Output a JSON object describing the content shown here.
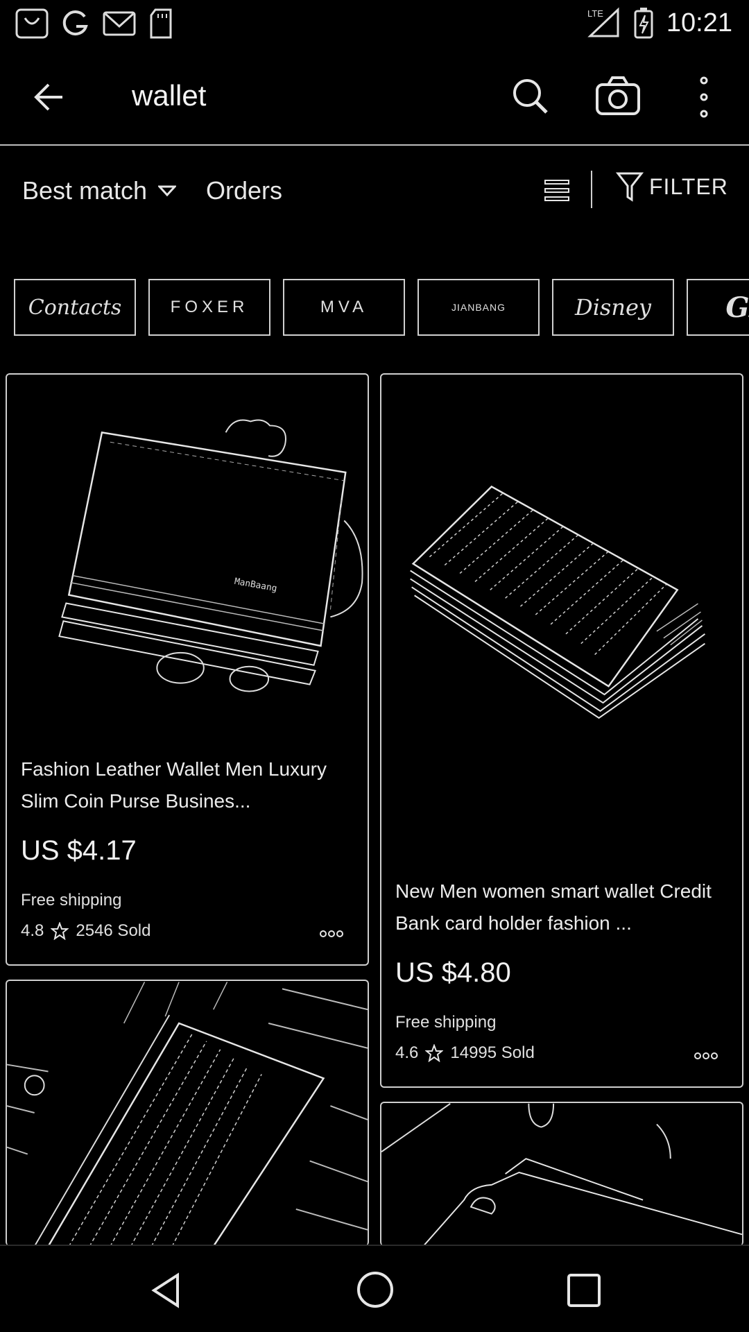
{
  "status_bar": {
    "time": "10:21",
    "network_label": "LTE",
    "left_icons": [
      "aliexpress-icon",
      "google-icon",
      "gmail-icon",
      "sd-card-icon"
    ],
    "right_icons": [
      "lte-signal-icon",
      "battery-charging-icon"
    ]
  },
  "app_bar": {
    "search_query": "wallet",
    "icons": [
      "back-arrow-icon",
      "search-icon",
      "camera-icon",
      "more-vert-icon"
    ]
  },
  "sort_bar": {
    "best_match_label": "Best match",
    "orders_label": "Orders",
    "filter_label": "FILTER"
  },
  "brands": [
    {
      "label": "Contacts",
      "style": "script"
    },
    {
      "label": "FOXER",
      "style": "caps"
    },
    {
      "label": "MVA",
      "style": "caps"
    },
    {
      "label": "JIANBANG",
      "style": "small"
    },
    {
      "label": "Disney",
      "style": "disney"
    },
    {
      "label": "GZ",
      "style": "gz"
    }
  ],
  "products": [
    {
      "title": "Fashion Leather Wallet Men Luxury Slim Coin Purse Busines...",
      "price": "US $4.17",
      "shipping": "Free shipping",
      "rating": "4.8",
      "sold": "2546 Sold",
      "image_label": "Leather Wallet Image"
    },
    {
      "title": "New Men women smart wallet Credit Bank card holder fashion ...",
      "price": "US $4.80",
      "shipping": "Free shipping",
      "rating": "4.6",
      "sold": "14995 Sold",
      "image_label": "Card Holder Wallet Image"
    }
  ],
  "colors": {
    "background": "#000000",
    "outline": "#d8d8d8",
    "text": "#ececec"
  }
}
